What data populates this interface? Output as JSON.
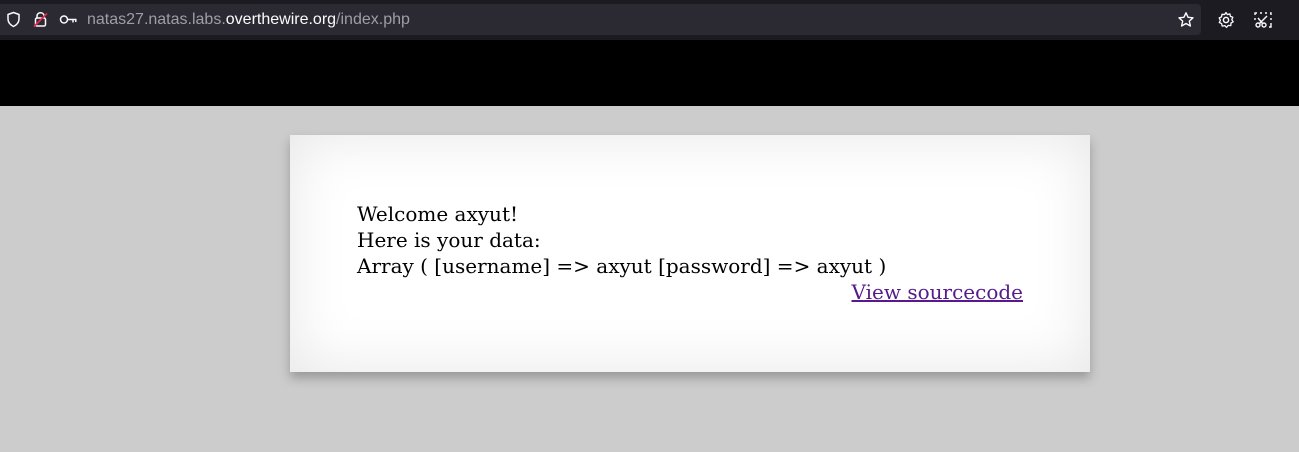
{
  "browser": {
    "url": {
      "prefix": "natas27.natas.labs.",
      "host_main": "overthewire.org",
      "path": "/index.php"
    },
    "icons": {
      "tracking_protection": "shield-icon",
      "insecure_lock": "lock-icon",
      "permissions_key": "key-icon",
      "bookmark": "star-icon",
      "settings": "gear-icon",
      "screenshot": "screenshot-icon"
    }
  },
  "page": {
    "welcome_line": "Welcome axyut!",
    "data_intro": "Here is your data:",
    "data_dump": "Array ( [username] => axyut [password] => axyut )",
    "view_source_link": "View sourcecode"
  },
  "colors": {
    "header_bg": "#000000",
    "page_bg": "#cccccc",
    "link_visited": "#551a8b",
    "lock_insecure": "#e22850"
  }
}
